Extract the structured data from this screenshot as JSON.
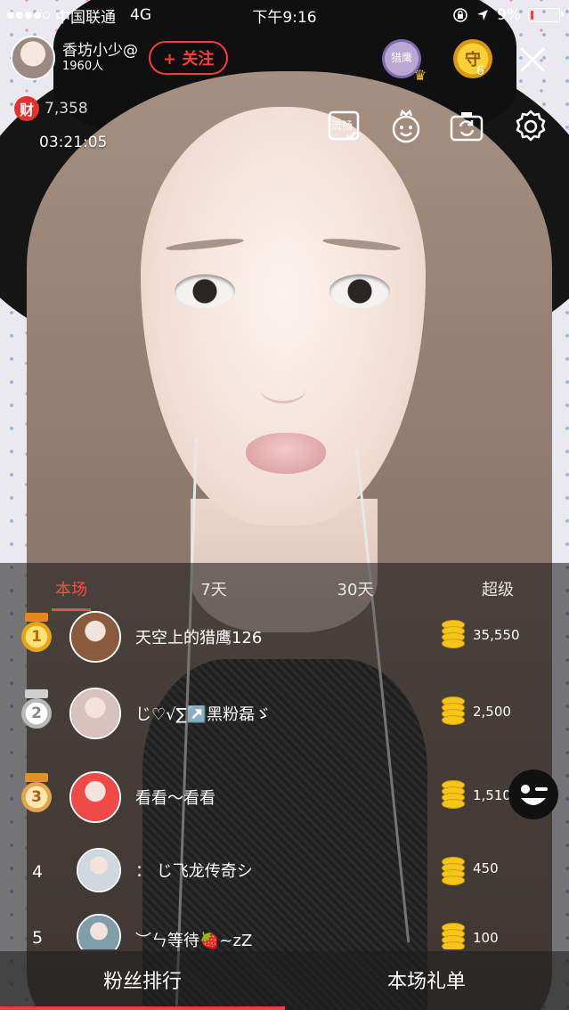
{
  "status_bar": {
    "carrier": "中国联通",
    "network": "4G",
    "time": "下午9:16",
    "battery": "9%",
    "battery_level": 0.09
  },
  "header": {
    "host_name": "香坊小少@",
    "host_fans": "1960人",
    "follow_label": "+ 关注",
    "wealth_badge": "财",
    "wealth_value": "7,358",
    "timer": "03:21:05",
    "guard_count": "6",
    "guard_badge": "守",
    "vip_badge_text": "猎鹰"
  },
  "tools": {
    "smooth_label": "流畅"
  },
  "ranking": {
    "tabs": [
      {
        "label": "本场",
        "active": true
      },
      {
        "label": "7天",
        "active": false
      },
      {
        "label": "30天",
        "active": false
      },
      {
        "label": "超级",
        "active": false
      }
    ],
    "rows": [
      {
        "rank": "1",
        "name": "天空上的猎鹰126",
        "amount": "35,550",
        "medal": "gold",
        "avatar_color": "#8a5a3c"
      },
      {
        "rank": "2",
        "name": "じ♡√∑↗️黑粉磊ゞ",
        "amount": "2,500",
        "medal": "silver",
        "avatar_color": "#d8c2bd"
      },
      {
        "rank": "3",
        "name": "看看～看看",
        "amount": "1,510",
        "medal": "bronze",
        "avatar_color": "#f04a48"
      },
      {
        "rank": "4",
        "name": "： じ飞龙传奇シ",
        "amount": "450",
        "medal": "",
        "avatar_color": "#cfd8df"
      },
      {
        "rank": "5",
        "name": "︶ㄣ等待🍓~zZ",
        "amount": "100",
        "medal": "",
        "avatar_color": "#7f9eaa"
      }
    ]
  },
  "bottom_tabs": {
    "left": "粉丝排行",
    "right": "本场礼单"
  },
  "colors": {
    "accent": "#ff4a3f",
    "coin": "#f5c518"
  }
}
